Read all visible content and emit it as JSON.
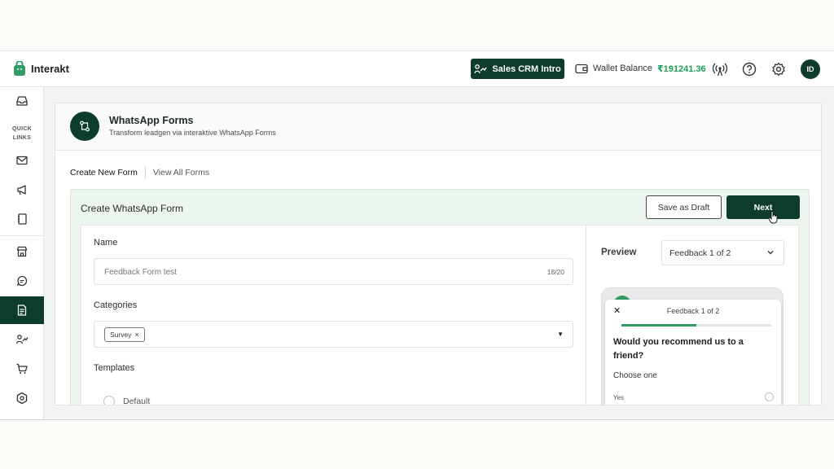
{
  "app": {
    "brand": "Interakt",
    "crm_button": "Sales CRM Intro",
    "wallet_label": "Wallet Balance",
    "wallet_amount": "₹191241.36",
    "avatar_initials": "ID",
    "accent_color": "#0d3b2e",
    "success_color": "#2f9e63"
  },
  "sidebar": {
    "quick_links_line1": "QUICK",
    "quick_links_line2": "LINKS",
    "items": [
      {
        "icon": "inbox-icon"
      },
      {
        "icon": "mail-icon"
      },
      {
        "icon": "megaphone-icon"
      },
      {
        "icon": "notebook-icon"
      },
      {
        "icon": "store-icon"
      },
      {
        "icon": "chat-icon"
      },
      {
        "icon": "form-icon",
        "active": true
      },
      {
        "icon": "sales-icon"
      },
      {
        "icon": "cart-icon"
      },
      {
        "icon": "hexagon-settings-icon"
      }
    ]
  },
  "header": {
    "title": "WhatsApp Forms",
    "subtitle": "Transform leadgen via interaktive WhatsApp Forms"
  },
  "tabs": {
    "create": "Create New Form",
    "view": "View All Forms"
  },
  "form": {
    "title": "Create WhatsApp Form",
    "draft_button": "Save as Draft",
    "next_button": "Next",
    "name_label": "Name",
    "name_value": "Feedback Form test",
    "name_count": "18/20",
    "categories_label": "Categories",
    "category_chip": "Survey",
    "chip_remove": "×",
    "select_caret": "▼",
    "templates_label": "Templates",
    "template_option": "Default"
  },
  "preview": {
    "label": "Preview",
    "selected_screen": "Feedback 1 of 2",
    "sheet_close": "✕",
    "sheet_title": "Feedback 1 of 2",
    "progress_fraction": 0.5,
    "question": "Would you recommend us to a friend?",
    "choose": "Choose one",
    "option_yes": "Yes"
  }
}
